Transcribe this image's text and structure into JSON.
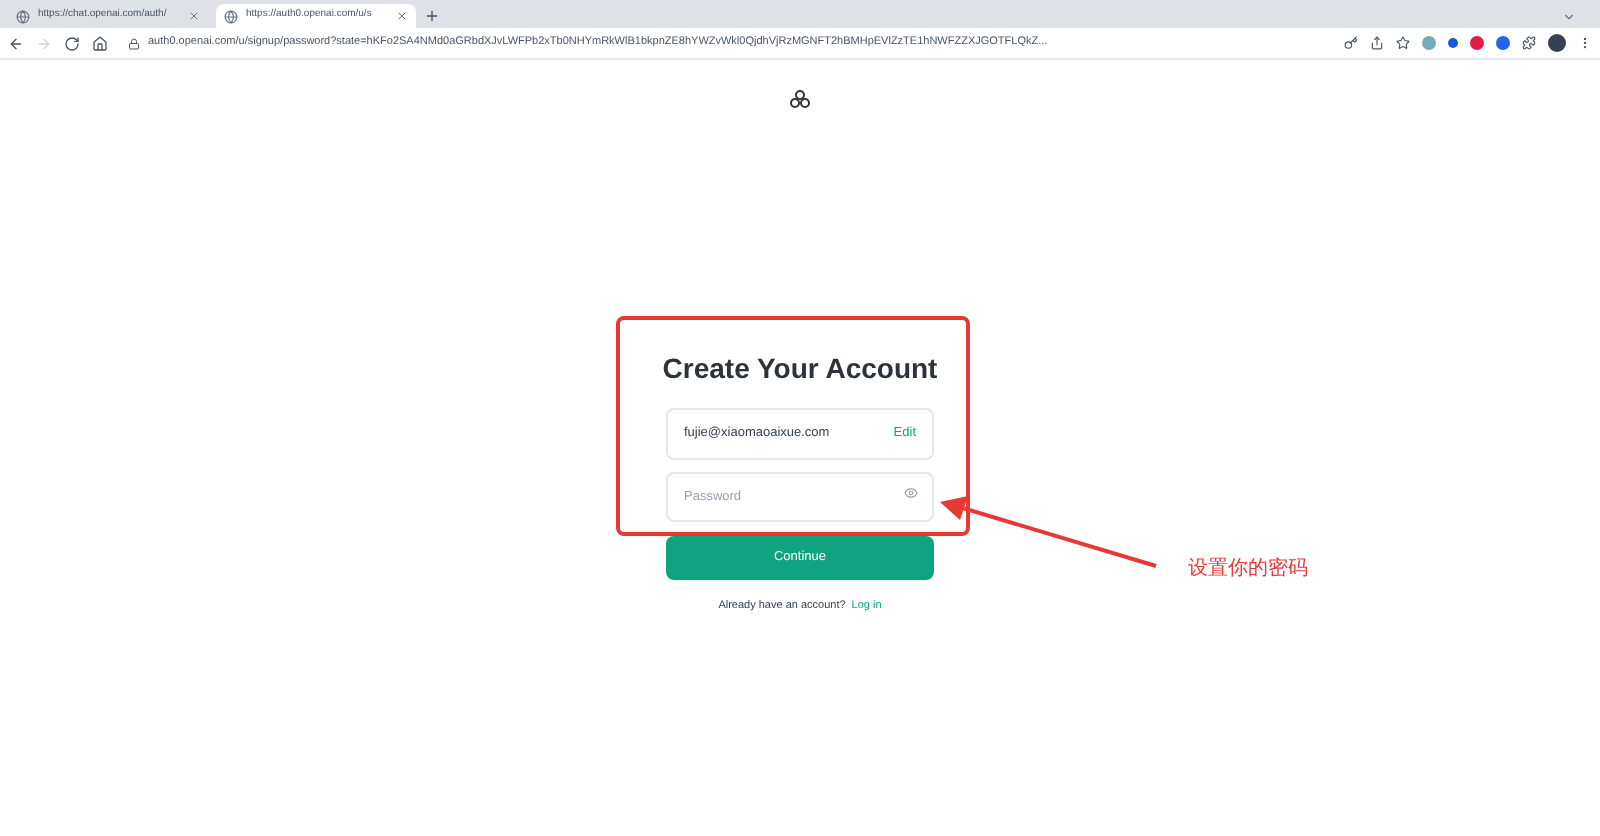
{
  "tabs": [
    {
      "title": "https://chat.openai.com/auth/",
      "selected": false
    },
    {
      "title": "https://auth0.openai.com/u/s",
      "selected": true
    }
  ],
  "address": "auth0.openai.com/u/signup/password?state=hKFo2SA4NMd0aGRbdXJvLWFPb2xTb0NHYmRkWlB1bkpnZE8hYWZvWkl0QjdhVjRzMGNFT2hBMHpEVlZzTE1hNWFZZXJGOTFLQkZ...",
  "form": {
    "title": "Create Your Account",
    "email": "fujie@xiaomaoaixue.com",
    "edit": "Edit",
    "password_placeholder": "Password",
    "button": "Continue",
    "prompt": "Already have an account?",
    "login": "Log in"
  },
  "annotation": "设置你的密码"
}
